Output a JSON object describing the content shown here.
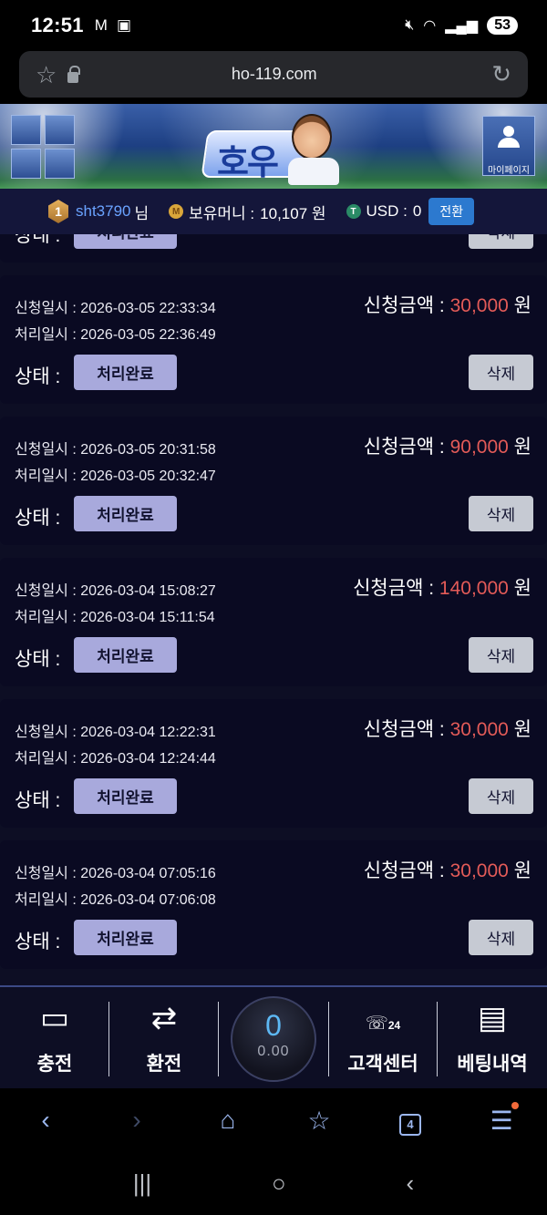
{
  "status_bar": {
    "time": "12:51",
    "battery": "53",
    "left_icons": [
      "gmail-icon",
      "screenshot-icon"
    ],
    "right_icons": [
      "mute-icon",
      "wifi-icon",
      "signal-icon"
    ]
  },
  "browser": {
    "url": "ho-119.com",
    "tab_count": "4"
  },
  "user": {
    "rank": "1",
    "username": "sht3790",
    "honorific": "님",
    "money_label": "보유머니 :",
    "money_value": "10,107 원",
    "usd_label": "USD :",
    "usd_value": "0",
    "switch_label": "전환"
  },
  "header": {
    "logo_text": "호우",
    "mypage_label": "마이페이지"
  },
  "partial_card": {
    "status_label": "상태 :",
    "status_value": "처리완료",
    "delete_label": "삭제"
  },
  "records": [
    {
      "request_label": "신청일시 :",
      "request_time": "2026-03-05 22:33:34",
      "process_label": "처리일시 :",
      "process_time": "2026-03-05 22:36:49",
      "amount_label": "신청금액 :",
      "amount": "30,000",
      "unit": "원",
      "status_label": "상태 :",
      "status_value": "처리완료",
      "delete_label": "삭제"
    },
    {
      "request_label": "신청일시 :",
      "request_time": "2026-03-05 20:31:58",
      "process_label": "처리일시 :",
      "process_time": "2026-03-05 20:32:47",
      "amount_label": "신청금액 :",
      "amount": "90,000",
      "unit": "원",
      "status_label": "상태 :",
      "status_value": "처리완료",
      "delete_label": "삭제"
    },
    {
      "request_label": "신청일시 :",
      "request_time": "2026-03-04 15:08:27",
      "process_label": "처리일시 :",
      "process_time": "2026-03-04 15:11:54",
      "amount_label": "신청금액 :",
      "amount": "140,000",
      "unit": "원",
      "status_label": "상태 :",
      "status_value": "처리완료",
      "delete_label": "삭제"
    },
    {
      "request_label": "신청일시 :",
      "request_time": "2026-03-04 12:22:31",
      "process_label": "처리일시 :",
      "process_time": "2026-03-04 12:24:44",
      "amount_label": "신청금액 :",
      "amount": "30,000",
      "unit": "원",
      "status_label": "상태 :",
      "status_value": "처리완료",
      "delete_label": "삭제"
    },
    {
      "request_label": "신청일시 :",
      "request_time": "2026-03-04 07:05:16",
      "process_label": "처리일시 :",
      "process_time": "2026-03-04 07:06:08",
      "amount_label": "신청금액 :",
      "amount": "30,000",
      "unit": "원",
      "status_label": "상태 :",
      "status_value": "처리완료",
      "delete_label": "삭제"
    }
  ],
  "bottom_nav": {
    "deposit": "충전",
    "withdraw": "환전",
    "center_count": "0",
    "center_balance": "0.00",
    "support": "고객센터",
    "bet_history": "베팅내역",
    "support_badge": "24"
  },
  "colors": {
    "amount_red": "#e35b58",
    "status_button": "#a8a9dc",
    "delete_button": "#c6cad3",
    "username_blue": "#6aa3ff",
    "switch_blue": "#2c79cf"
  }
}
